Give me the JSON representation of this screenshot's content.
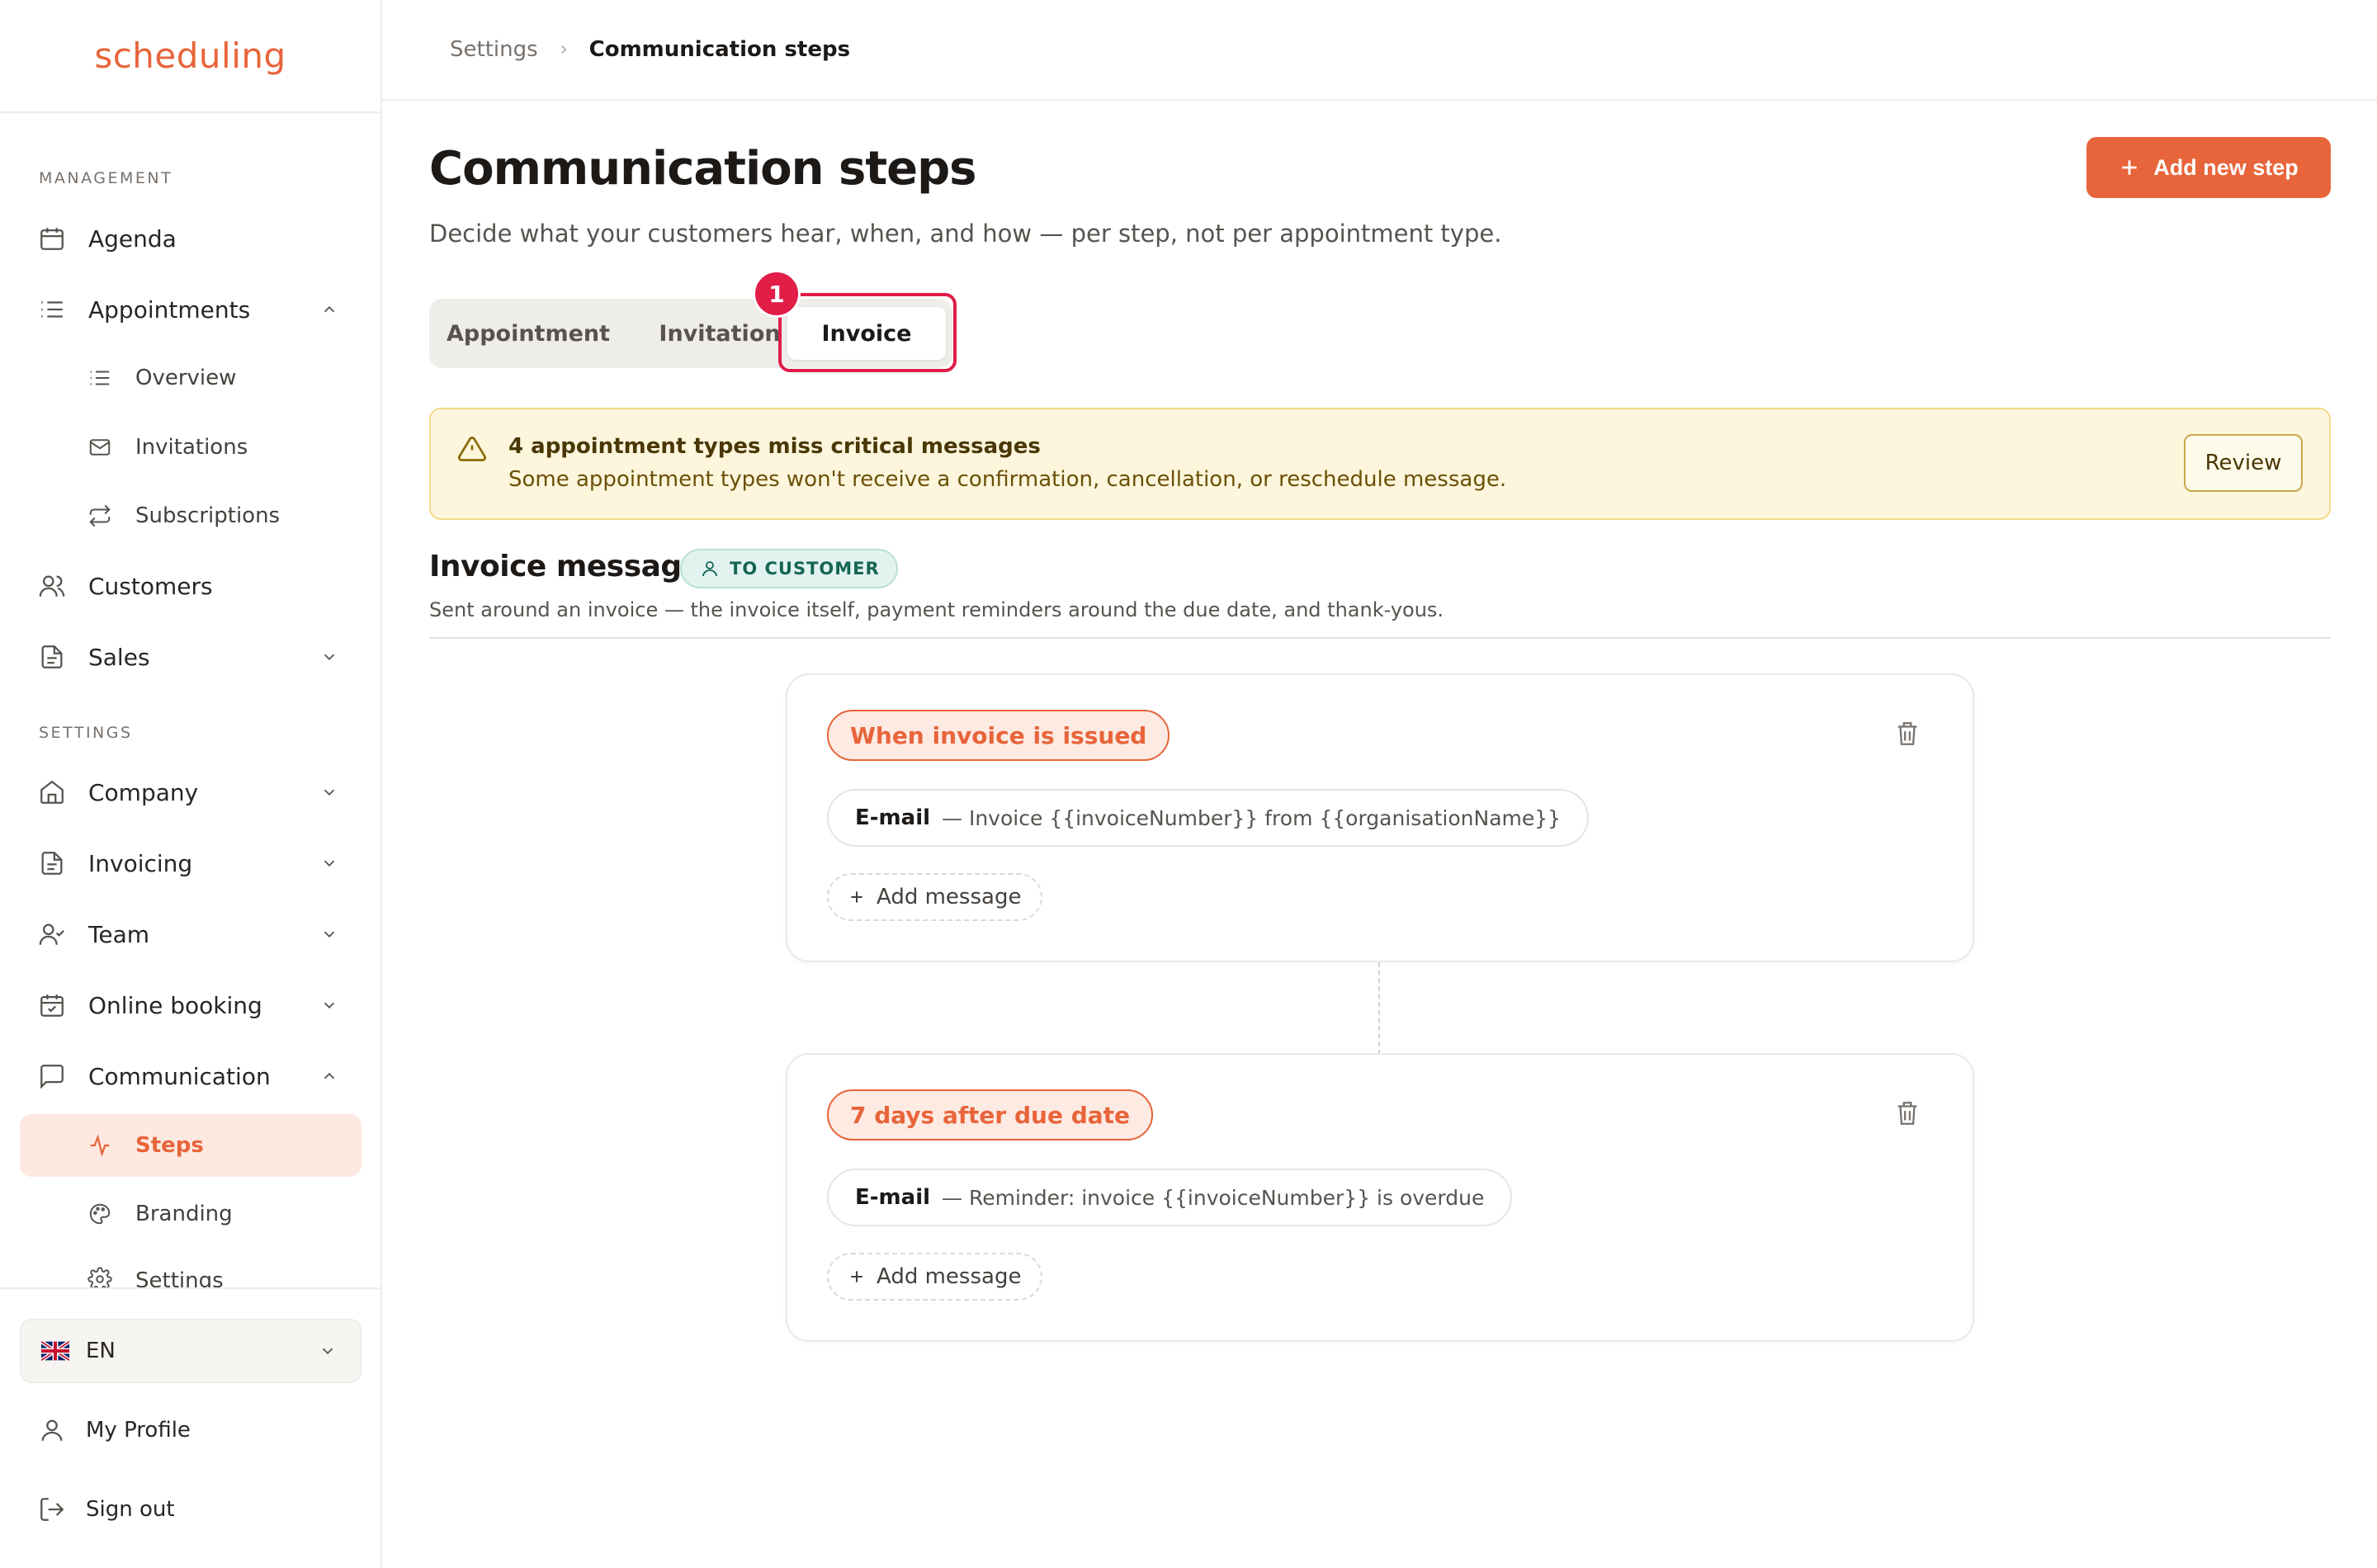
{
  "app": {
    "logo": "scheduling"
  },
  "sidebar": {
    "management_label": "MANAGEMENT",
    "settings_label": "SETTINGS",
    "items": {
      "agenda": "Agenda",
      "appointments": "Appointments",
      "overview": "Overview",
      "invitations": "Invitations",
      "subscriptions": "Subscriptions",
      "customers": "Customers",
      "sales": "Sales",
      "company": "Company",
      "invoicing": "Invoicing",
      "team": "Team",
      "online_booking": "Online booking",
      "communication": "Communication",
      "steps": "Steps",
      "branding": "Branding",
      "settings": "Settings"
    },
    "footer": {
      "language": "EN",
      "my_profile": "My Profile",
      "sign_out": "Sign out"
    }
  },
  "breadcrumb": {
    "parent": "Settings",
    "current": "Communication steps"
  },
  "page": {
    "title": "Communication steps",
    "subtitle": "Decide what your customers hear, when, and how — per step, not per appointment type.",
    "add_button": "Add new step"
  },
  "tabs": [
    {
      "label": "Appointment",
      "active": false
    },
    {
      "label": "Invitation",
      "active": false
    },
    {
      "label": "Invoice",
      "active": true
    }
  ],
  "annotation_marker": "1",
  "alert": {
    "title": "4 appointment types miss critical messages",
    "text": "Some appointment types won't receive a confirmation, cancellation, or reschedule message.",
    "button": "Review"
  },
  "section": {
    "title": "Invoice messages",
    "badge": "TO CUSTOMER",
    "description": "Sent around an invoice — the invoice itself, payment reminders around the due date, and thank-yous."
  },
  "steps": [
    {
      "trigger": "When invoice is issued",
      "messages": [
        {
          "channel": "E-mail",
          "subject": "— Invoice {{invoiceNumber}} from {{organisationName}}"
        }
      ],
      "add_label": "Add message"
    },
    {
      "trigger": "7 days after due date",
      "messages": [
        {
          "channel": "E-mail",
          "subject": "— Reminder: invoice {{invoiceNumber}} is overdue"
        }
      ],
      "add_label": "Add message"
    }
  ],
  "colors": {
    "brand": "#e8643a",
    "active_bg": "#fde9e1",
    "alert_bg": "#fdf6dc",
    "annotation": "#e11d48",
    "badge_teal": "#156556"
  }
}
